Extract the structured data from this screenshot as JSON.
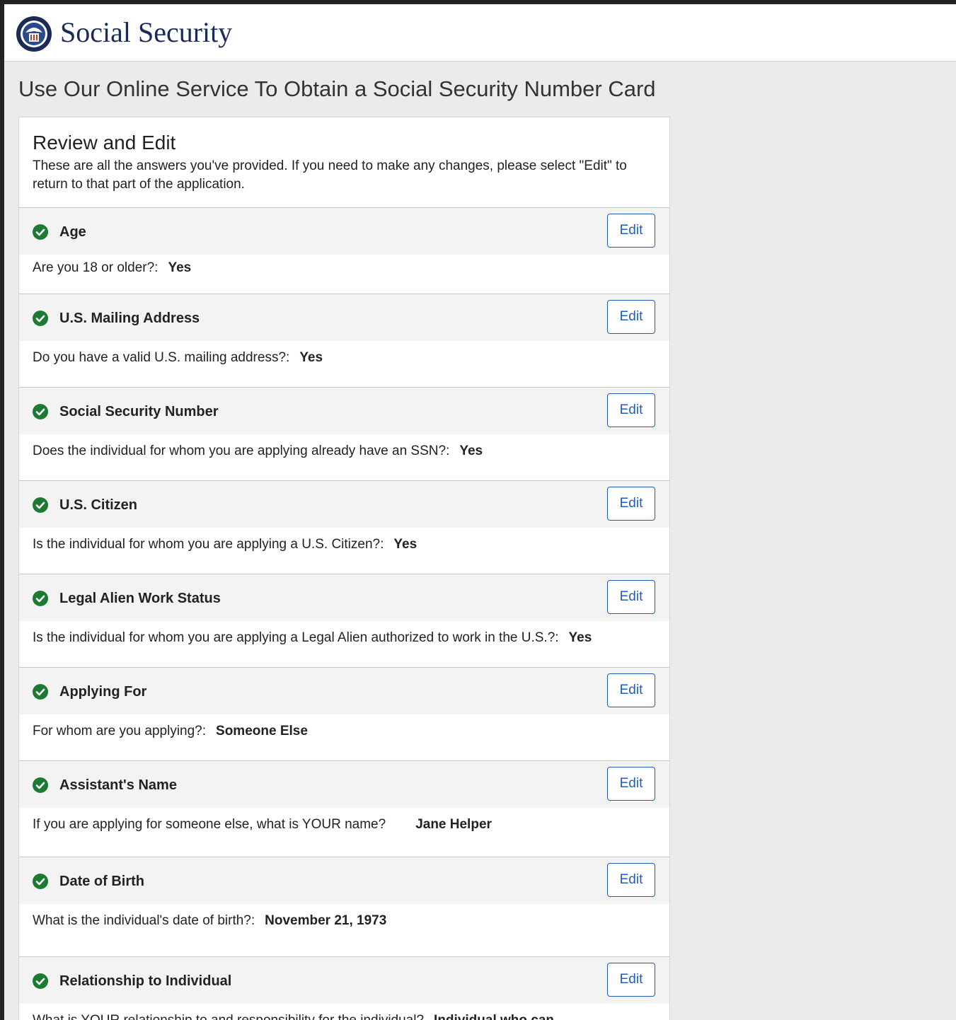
{
  "header": {
    "brand": "Social Security",
    "logo_icon": "ssa-seal-icon"
  },
  "page_title": "Use Our Online Service To Obtain a Social Security Number Card",
  "review": {
    "heading": "Review and Edit",
    "instructions": "These are all the answers you've provided. If you need to make any changes, please select \"Edit\" to return to that part of the application."
  },
  "edit_label": "Edit",
  "colors": {
    "brand": "#1a2b57",
    "check_green": "#1e7a33",
    "edit_blue": "#1f5db8"
  },
  "sections": [
    {
      "title": "Age",
      "question": "Are you 18 or older?:",
      "answer": "Yes"
    },
    {
      "title": "U.S. Mailing Address",
      "question": "Do you have a valid U.S. mailing address?:",
      "answer": "Yes"
    },
    {
      "title": "Social Security Number",
      "question": "Does the individual for whom you are applying already have an SSN?:",
      "answer": "Yes"
    },
    {
      "title": "U.S. Citizen",
      "question": "Is the individual for whom you are applying a U.S. Citizen?:",
      "answer": "Yes"
    },
    {
      "title": "Legal Alien Work Status",
      "question": "Is the individual for whom you are applying a Legal Alien authorized to work in the U.S.?:",
      "answer": "Yes"
    },
    {
      "title": "Applying For",
      "question": "For whom are you applying?:",
      "answer": "Someone Else"
    },
    {
      "title": "Assistant's Name",
      "question": "If you are applying for someone else, what is YOUR name?",
      "answer": "Jane Helper"
    },
    {
      "title": "Date of Birth",
      "question": "What is the individual's date of birth?:",
      "answer": "November 21, 1973"
    },
    {
      "title": "Relationship to Individual",
      "question": "What is YOUR relationship to and responsibility for the individual?",
      "answer": "Individual who can"
    }
  ]
}
